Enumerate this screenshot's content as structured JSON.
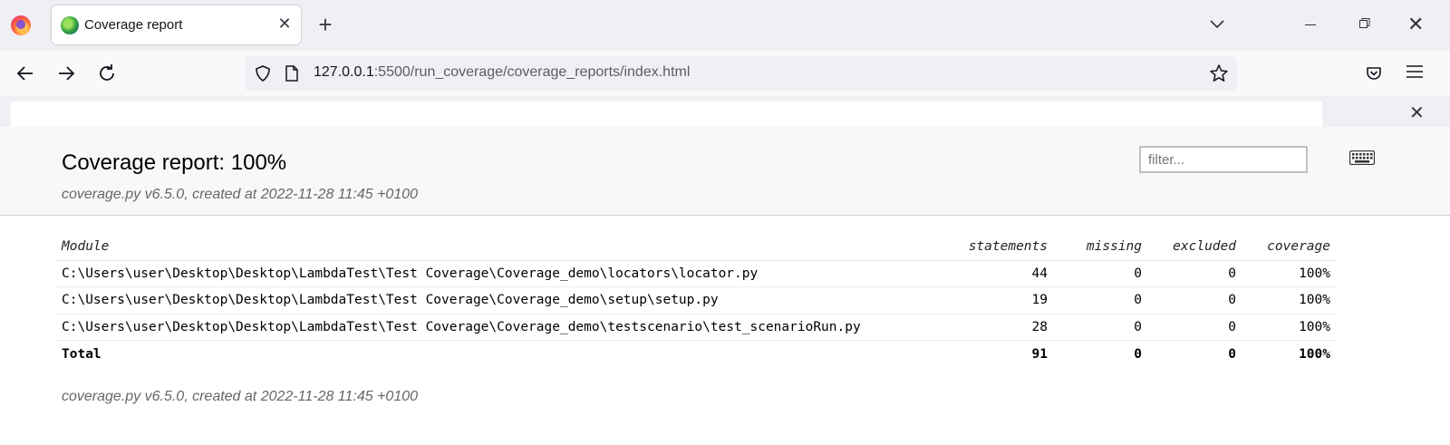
{
  "browser": {
    "tab": {
      "title": "Coverage report"
    },
    "url": {
      "host": "127.0.0.1",
      "rest": ":5500/run_coverage/coverage_reports/index.html"
    }
  },
  "report": {
    "title": "Coverage report: 100%",
    "subtitle": "coverage.py v6.5.0, created at 2022-11-28 11:45 +0100",
    "filter_placeholder": "filter...",
    "columns": {
      "module": "Module",
      "statements": "statements",
      "missing": "missing",
      "excluded": "excluded",
      "coverage": "coverage"
    },
    "rows": [
      {
        "module": "C:\\Users\\user\\Desktop\\Desktop\\LambdaTest\\Test Coverage\\Coverage_demo\\locators\\locator.py",
        "statements": "44",
        "missing": "0",
        "excluded": "0",
        "coverage": "100%"
      },
      {
        "module": "C:\\Users\\user\\Desktop\\Desktop\\LambdaTest\\Test Coverage\\Coverage_demo\\setup\\setup.py",
        "statements": "19",
        "missing": "0",
        "excluded": "0",
        "coverage": "100%"
      },
      {
        "module": "C:\\Users\\user\\Desktop\\Desktop\\LambdaTest\\Test Coverage\\Coverage_demo\\testscenario\\test_scenarioRun.py",
        "statements": "28",
        "missing": "0",
        "excluded": "0",
        "coverage": "100%"
      }
    ],
    "total": {
      "label": "Total",
      "statements": "91",
      "missing": "0",
      "excluded": "0",
      "coverage": "100%"
    },
    "footer": "coverage.py v6.5.0, created at 2022-11-28 11:45 +0100"
  },
  "icons": [
    "firefox-logo-icon",
    "favicon-icon",
    "close-icon",
    "plus-icon",
    "chevron-down-icon",
    "minimize-icon",
    "restore-icon",
    "back-icon",
    "forward-icon",
    "reload-icon",
    "shield-icon",
    "page-icon",
    "star-icon",
    "pocket-icon",
    "menu-icon",
    "keyboard-icon"
  ]
}
